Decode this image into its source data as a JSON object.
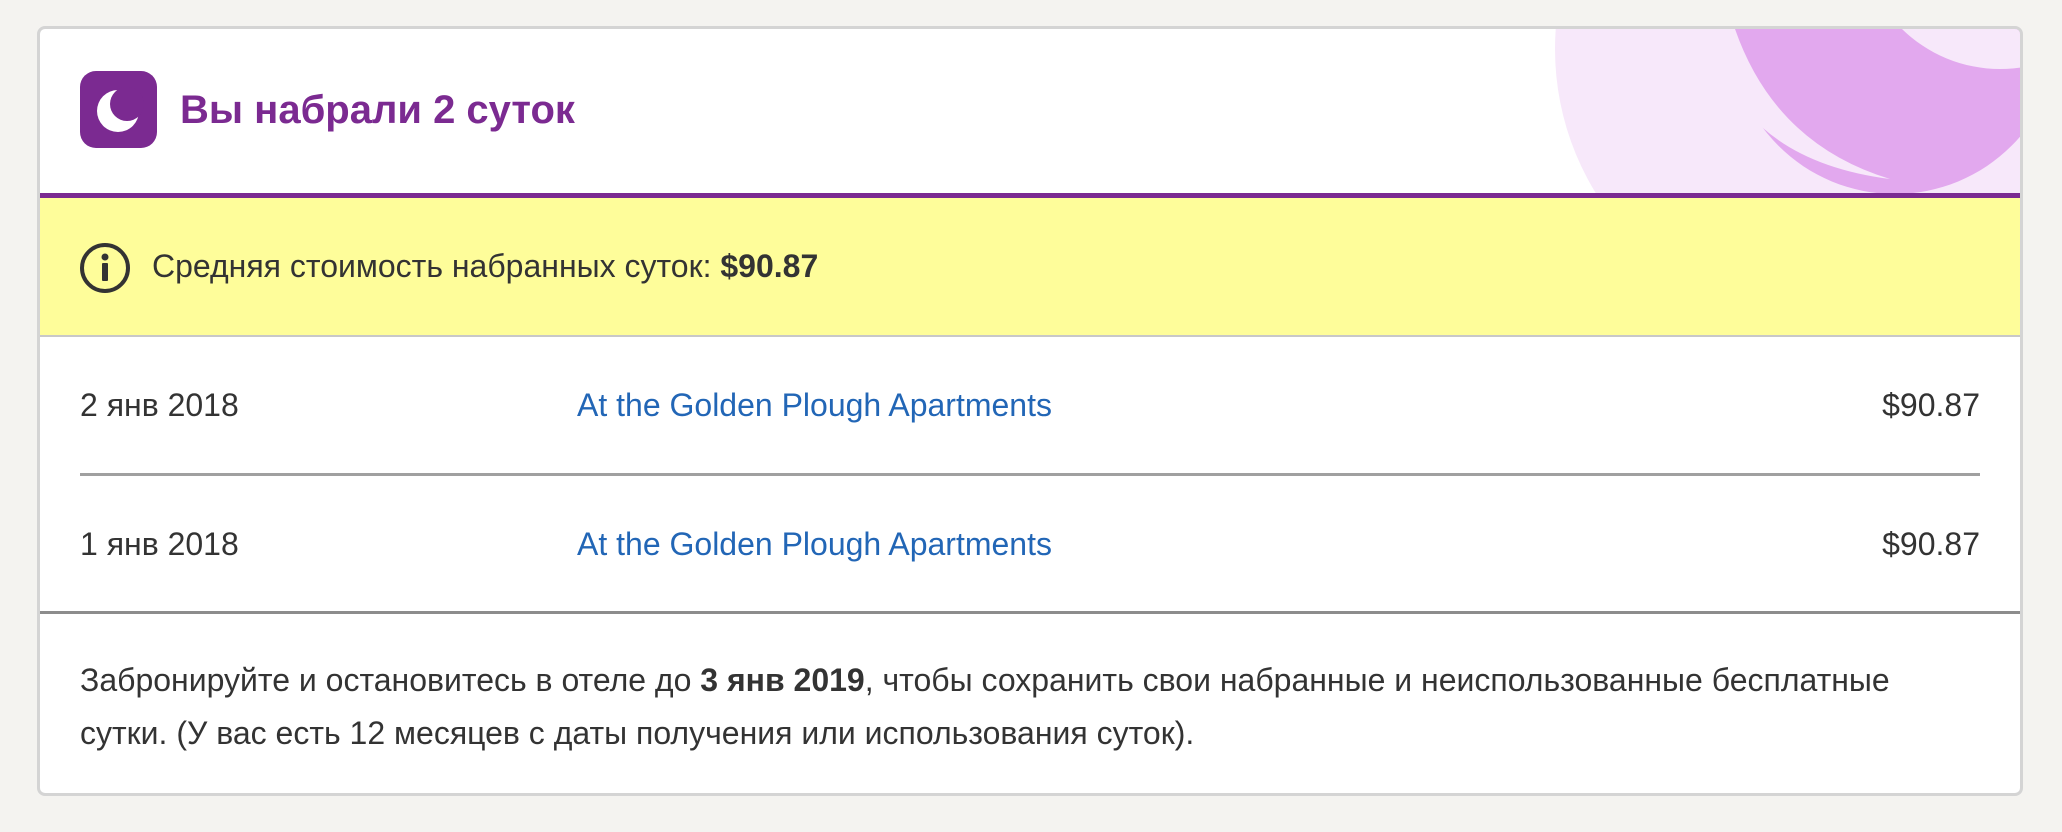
{
  "header": {
    "icon": "moon-icon",
    "title": "Вы набрали 2 суток",
    "accent_color": "#7b2a91"
  },
  "notice": {
    "icon": "info-icon",
    "label": "Средняя стоимость набранных суток: ",
    "amount": "$90.87",
    "background_color": "#fefd9a"
  },
  "nights": [
    {
      "date": "2 янв 2018",
      "hotel": "At the Golden Plough Apartments",
      "price": "$90.87"
    },
    {
      "date": "1 янв 2018",
      "hotel": "At the Golden Plough Apartments",
      "price": "$90.87"
    }
  ],
  "footer": {
    "text_before": "Забронируйте и остановитесь в отеле до ",
    "deadline": "3 янв 2019",
    "text_after": ", чтобы сохранить свои набранные и неиспользованные бесплатные сутки. (У вас есть 12 месяцев с даты получения или использования суток)."
  },
  "colors": {
    "link": "#2266b6",
    "text": "#333333"
  }
}
